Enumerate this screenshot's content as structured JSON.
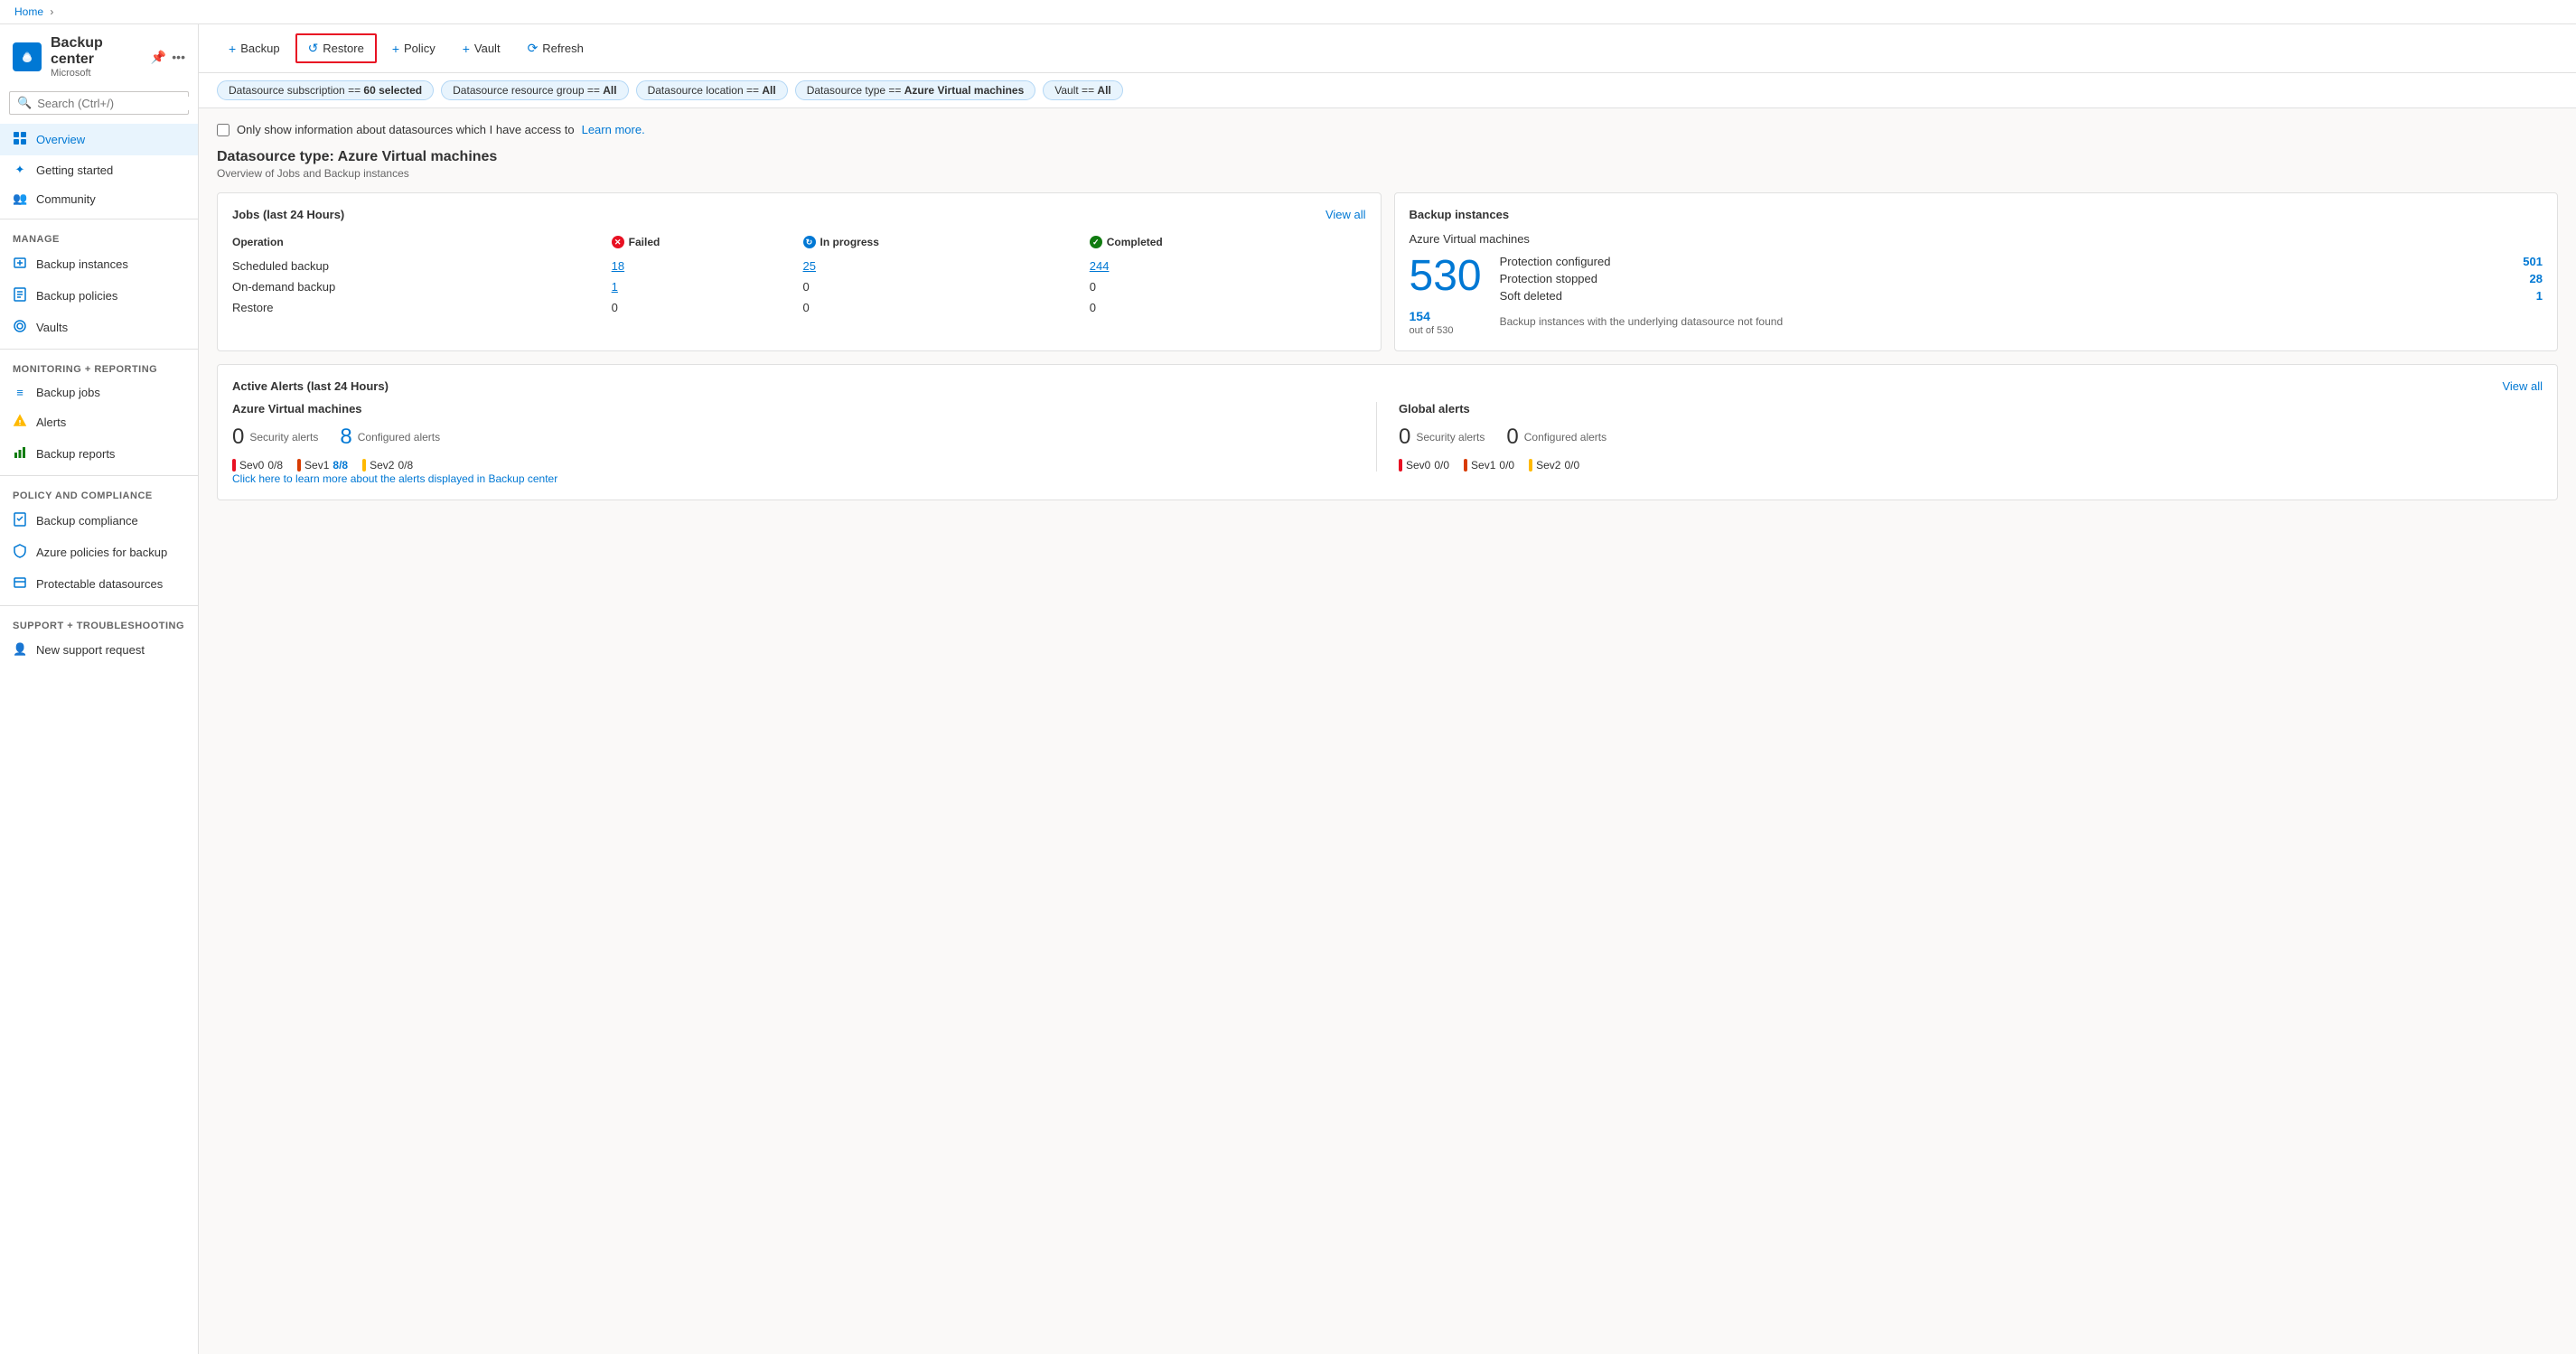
{
  "breadcrumb": {
    "home": "Home",
    "separator": "›"
  },
  "sidebar": {
    "logo_icon": "☁",
    "title": "Backup center",
    "subtitle": "Microsoft",
    "pin_icon": "📌",
    "more_icon": "•••",
    "search": {
      "placeholder": "Search (Ctrl+/)"
    },
    "collapse_icon": "«",
    "nav_items": [
      {
        "id": "overview",
        "label": "Overview",
        "icon": "⊞",
        "active": true
      },
      {
        "id": "getting-started",
        "label": "Getting started",
        "icon": "✦"
      },
      {
        "id": "community",
        "label": "Community",
        "icon": "👥"
      }
    ],
    "sections": [
      {
        "label": "Manage",
        "items": [
          {
            "id": "backup-instances",
            "label": "Backup instances",
            "icon": "💾"
          },
          {
            "id": "backup-policies",
            "label": "Backup policies",
            "icon": "📋"
          },
          {
            "id": "vaults",
            "label": "Vaults",
            "icon": "🏦"
          }
        ]
      },
      {
        "label": "Monitoring + reporting",
        "items": [
          {
            "id": "backup-jobs",
            "label": "Backup jobs",
            "icon": "≡"
          },
          {
            "id": "alerts",
            "label": "Alerts",
            "icon": "⚠"
          },
          {
            "id": "backup-reports",
            "label": "Backup reports",
            "icon": "📊"
          }
        ]
      },
      {
        "label": "Policy and compliance",
        "items": [
          {
            "id": "backup-compliance",
            "label": "Backup compliance",
            "icon": "📄"
          },
          {
            "id": "azure-policies",
            "label": "Azure policies for backup",
            "icon": "🛡"
          },
          {
            "id": "protectable-datasources",
            "label": "Protectable datasources",
            "icon": "📁"
          }
        ]
      },
      {
        "label": "Support + troubleshooting",
        "items": [
          {
            "id": "new-support",
            "label": "New support request",
            "icon": "👤"
          }
        ]
      }
    ]
  },
  "toolbar": {
    "backup_label": "+ Backup",
    "restore_label": "Restore",
    "policy_label": "+ Policy",
    "vault_label": "+ Vault",
    "refresh_label": "Refresh"
  },
  "filters": [
    {
      "id": "subscription",
      "text": "Datasource subscription == ",
      "bold": "60 selected"
    },
    {
      "id": "resource-group",
      "text": "Datasource resource group == ",
      "bold": "All"
    },
    {
      "id": "location",
      "text": "Datasource location == ",
      "bold": "All"
    },
    {
      "id": "datasource-type",
      "text": "Datasource type == ",
      "bold": "Azure Virtual machines"
    },
    {
      "id": "vault",
      "text": "Vault == ",
      "bold": "All"
    }
  ],
  "datasource": {
    "type_label": "Datasource type: Azure Virtual machines",
    "subtitle": "Overview of Jobs and Backup instances",
    "checkbox_label": "Only show information about datasources which I have access to",
    "learn_more_label": "Learn more."
  },
  "jobs_card": {
    "title": "Jobs (last 24 Hours)",
    "view_all": "View all",
    "col_operation": "Operation",
    "col_failed": "Failed",
    "col_inprogress": "In progress",
    "col_completed": "Completed",
    "rows": [
      {
        "operation": "Scheduled backup",
        "failed": "18",
        "inprogress": "25",
        "completed": "244"
      },
      {
        "operation": "On-demand backup",
        "failed": "1",
        "inprogress": "0",
        "completed": "0"
      },
      {
        "operation": "Restore",
        "failed": "0",
        "inprogress": "0",
        "completed": "0"
      }
    ]
  },
  "backup_instances_card": {
    "title": "Backup instances",
    "section_title": "Azure Virtual machines",
    "big_number": "530",
    "protection_configured_label": "Protection configured",
    "protection_configured_value": "501",
    "protection_stopped_label": "Protection stopped",
    "protection_stopped_value": "28",
    "soft_deleted_label": "Soft deleted",
    "soft_deleted_value": "1",
    "underlying_number": "154",
    "underlying_outof": "out of 530",
    "underlying_label": "Backup instances with the underlying datasource not found"
  },
  "alerts_card": {
    "title": "Active Alerts (last 24 Hours)",
    "view_all": "View all",
    "azure_col": {
      "title": "Azure Virtual machines",
      "security_count": "0",
      "security_label": "Security alerts",
      "configured_count": "8",
      "configured_label": "Configured alerts",
      "sev_items": [
        {
          "sev": "Sev0",
          "count": "0",
          "total": "8",
          "color": "red"
        },
        {
          "sev": "Sev1",
          "count": "8",
          "total": "8",
          "color": "orange"
        },
        {
          "sev": "Sev2",
          "count": "0",
          "total": "8",
          "color": "yellow"
        }
      ]
    },
    "global_col": {
      "title": "Global alerts",
      "security_count": "0",
      "security_label": "Security alerts",
      "configured_count": "0",
      "configured_label": "Configured alerts",
      "sev_items": [
        {
          "sev": "Sev0",
          "count": "0",
          "total": "0",
          "color": "red"
        },
        {
          "sev": "Sev1",
          "count": "0",
          "total": "0",
          "color": "orange"
        },
        {
          "sev": "Sev2",
          "count": "0",
          "total": "0",
          "color": "yellow"
        }
      ]
    },
    "learn_more": "Click here to learn more about the alerts displayed in Backup center"
  }
}
